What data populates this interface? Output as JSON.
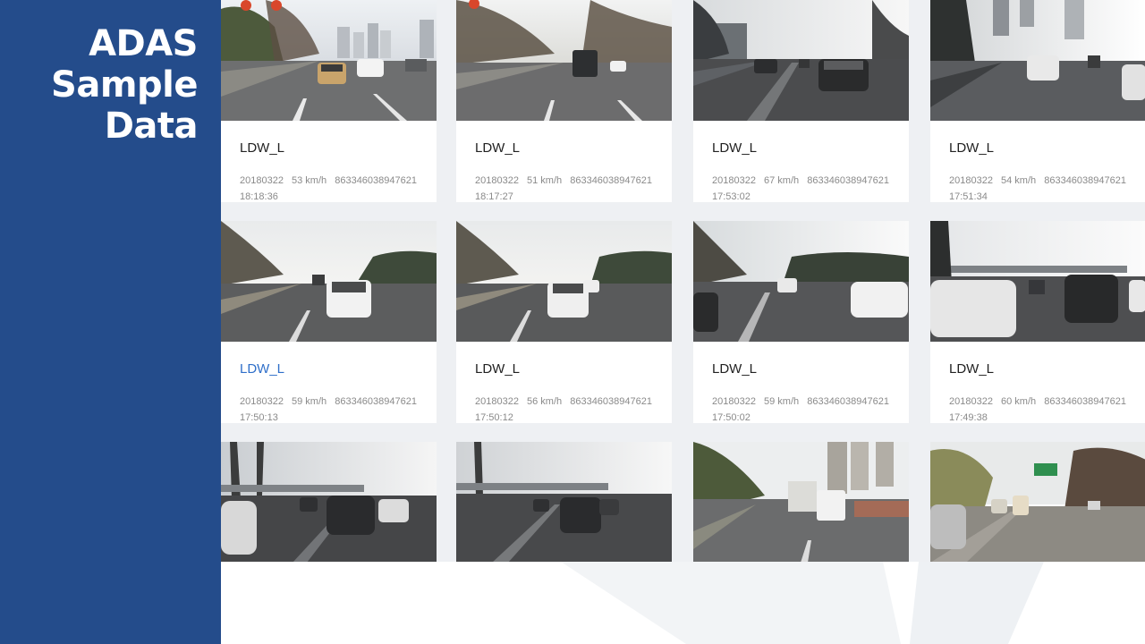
{
  "sidebar": {
    "title_line1": "ADAS",
    "title_line2": "Sample",
    "title_line3": "Data"
  },
  "colors": {
    "sidebar_bg": "#244c8b",
    "grid_bg": "#eef0f3",
    "active_label": "#2f6fc9"
  },
  "cards": [
    {
      "label": "LDW_L",
      "date": "20180322",
      "speed": "53 km/h",
      "device": "863346038947621",
      "time": "18:18:36",
      "active": false
    },
    {
      "label": "LDW_L",
      "date": "20180322",
      "speed": "51 km/h",
      "device": "863346038947621",
      "time": "18:17:27",
      "active": false
    },
    {
      "label": "LDW_L",
      "date": "20180322",
      "speed": "67 km/h",
      "device": "863346038947621",
      "time": "17:53:02",
      "active": false
    },
    {
      "label": "LDW_L",
      "date": "20180322",
      "speed": "54 km/h",
      "device": "863346038947621",
      "time": "17:51:34",
      "active": false
    },
    {
      "label": "LDW_L",
      "date": "20180322",
      "speed": "59 km/h",
      "device": "863346038947621",
      "time": "17:50:13",
      "active": true
    },
    {
      "label": "LDW_L",
      "date": "20180322",
      "speed": "56 km/h",
      "device": "863346038947621",
      "time": "17:50:12",
      "active": false
    },
    {
      "label": "LDW_L",
      "date": "20180322",
      "speed": "59 km/h",
      "device": "863346038947621",
      "time": "17:50:02",
      "active": false
    },
    {
      "label": "LDW_L",
      "date": "20180322",
      "speed": "60 km/h",
      "device": "863346038947621",
      "time": "17:49:38",
      "active": false
    },
    {
      "thumbnail_only": true
    },
    {
      "thumbnail_only": true
    },
    {
      "thumbnail_only": true
    },
    {
      "thumbnail_only": true
    }
  ]
}
